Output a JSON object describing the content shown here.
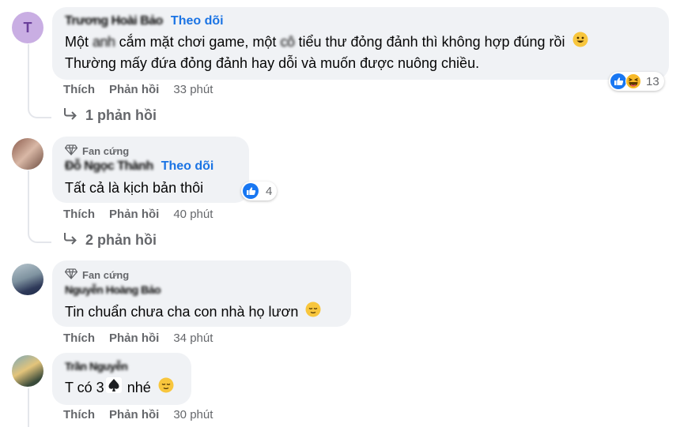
{
  "comments": [
    {
      "avatar_letter": "T",
      "name": "Trương Hoài Bảo",
      "follow": "Theo dõi",
      "line1": "Một ",
      "line1_blur": "anh",
      "line1_mid": " cắm mặt chơi game, một ",
      "line1_blur2": "cô",
      "line1_end": " tiểu thư đỏng đảnh thì không hợp đúng rồi",
      "line2": "Thường mấy đứa đỏng đảnh hay dỗi và muốn được nuông chiều.",
      "like": "Thích",
      "reply": "Phản hồi",
      "time": "33 phút",
      "reaction_count": "13",
      "replies": "1 phản hồi"
    },
    {
      "badge": "Fan cứng",
      "name": "Đỗ Ngọc Thành",
      "follow": "Theo dõi",
      "text": "Tất cả là kịch bản thôi",
      "like": "Thích",
      "reply": "Phản hồi",
      "time": "40 phút",
      "reaction_count": "4",
      "replies": "2 phản hồi"
    },
    {
      "badge": "Fan cứng",
      "name": "Nguyễn Hoàng Bảo",
      "text": "Tin chuẩn chưa cha con nhà họ lươn",
      "like": "Thích",
      "reply": "Phản hồi",
      "time": "34 phút"
    },
    {
      "name": "Trần Nguyễn",
      "text_before": "T có 3",
      "text_after": " nhé",
      "like": "Thích",
      "reply": "Phản hồi",
      "time": "30 phút"
    }
  ],
  "colors": {
    "link": "#1b74e4",
    "bubble": "#f0f2f5",
    "muted": "#65676b",
    "like_blue": "#1877f2"
  }
}
